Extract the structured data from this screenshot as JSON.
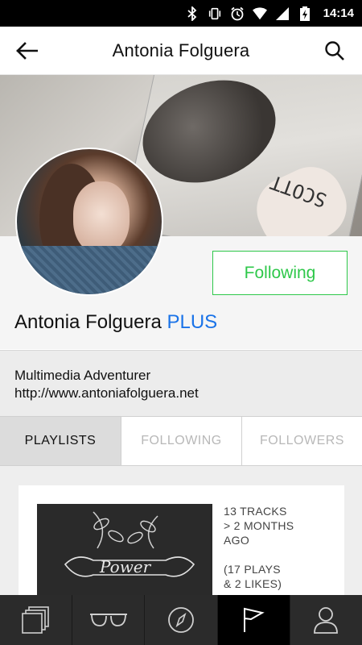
{
  "statusbar": {
    "time": "14:14",
    "icons": [
      "bluetooth-icon",
      "vibrate-icon",
      "alarm-icon",
      "wifi-icon",
      "signal-icon",
      "battery-icon"
    ]
  },
  "appbar": {
    "title": "Antonia Folguera",
    "back_icon": "back-arrow-icon",
    "search_icon": "search-icon"
  },
  "banner": {
    "record_text": "SCOTT"
  },
  "profile": {
    "name": "Antonia Folguera",
    "badge": "PLUS",
    "badge_color": "#1a73e8",
    "follow_label": "Following",
    "follow_color": "#2ec84a"
  },
  "bio": {
    "tagline": "Multimedia Adventurer",
    "website": "http://www.antoniafolguera.net"
  },
  "tabs": [
    {
      "label": "PLAYLISTS",
      "active": true
    },
    {
      "label": "FOLLOWING",
      "active": false
    },
    {
      "label": "FOLLOWERS",
      "active": false
    }
  ],
  "playlist": {
    "thumb_text": "Power",
    "meta": [
      "13 TRACKS",
      "> 2 MONTHS",
      "AGO",
      "",
      "(17 PLAYS",
      "& 2 LIKES)"
    ]
  },
  "bottomnav": [
    {
      "icon": "stack-icon",
      "active": false
    },
    {
      "icon": "glasses-icon",
      "active": false
    },
    {
      "icon": "compass-icon",
      "active": false
    },
    {
      "icon": "flag-icon",
      "active": true
    },
    {
      "icon": "person-icon",
      "active": false
    }
  ]
}
